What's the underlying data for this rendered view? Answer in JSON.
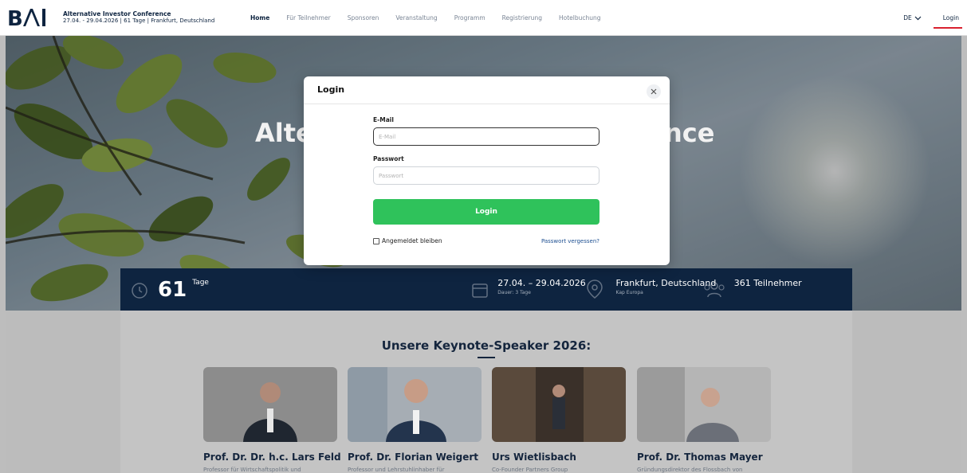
{
  "header": {
    "logo_text": "BAI",
    "conference_title": "Alternative Investor Conference",
    "conference_subtitle": "27.04. - 29.04.2026 | 61 Tage | Frankfurt, Deutschland",
    "nav": [
      "Home",
      "Für Teilnehmer",
      "Sponsoren",
      "Veranstaltung",
      "Programm",
      "Registrierung",
      "Hotelbuchung"
    ],
    "active_nav": "Home",
    "language": "DE",
    "login_label": "Login"
  },
  "hero": {
    "title_left": "Alte",
    "title_right": "nce"
  },
  "stats": {
    "days_number": "61",
    "days_label": "Tage",
    "date_range": "27.04. – 29.04.2026",
    "duration": "Dauer: 3 Tage",
    "location": "Frankfurt, Deutschland",
    "venue": "Kap Europa",
    "participants": "361 Teilnehmer"
  },
  "keynote": {
    "heading": "Unsere Keynote-Speaker 2026:",
    "speakers": [
      {
        "name": "Prof. Dr. Dr. h.c. Lars Feld",
        "role": "Professor für Wirtschaftspolitik und"
      },
      {
        "name": "Prof. Dr. Florian Weigert",
        "role": "Professor und Lehrstuhlinhaber für"
      },
      {
        "name": "Urs Wietlisbach",
        "role": "Co-Founder Partners Group"
      },
      {
        "name": "Prof. Dr. Thomas Mayer",
        "role": "Gründungsdirektor des Flossbach von"
      }
    ]
  },
  "modal": {
    "title": "Login",
    "email_label": "E-Mail",
    "email_placeholder": "E-Mail",
    "password_label": "Passwort",
    "password_placeholder": "Passwort",
    "submit_label": "Login",
    "remember_label": "Angemeldet bleiben",
    "forgot_label": "Passwort vergessen?"
  },
  "colors": {
    "navy": "#0e2440",
    "accent_red": "#d9212f",
    "login_green": "#2fc25b",
    "link_blue": "#1d4f91"
  }
}
